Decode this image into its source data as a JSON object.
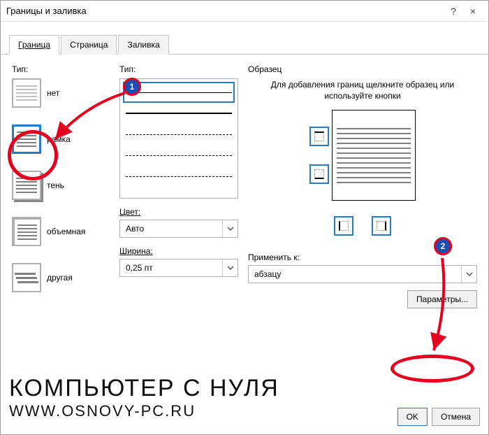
{
  "title": "Границы и заливка",
  "help": "?",
  "close": "×",
  "tabs": {
    "border": "Граница",
    "page": "Страница",
    "fill": "Заливка"
  },
  "type": {
    "label": "Тип:",
    "items": [
      "нет",
      "рамка",
      "тень",
      "объемная",
      "другая"
    ]
  },
  "style": {
    "label": "Тип:"
  },
  "color": {
    "label": "Цвет:",
    "value": "Авто"
  },
  "width": {
    "label": "Ширина:",
    "value": "0,25 пт"
  },
  "sample": {
    "label": "Образец",
    "hint": "Для добавления границ щелкните образец или используйте кнопки"
  },
  "apply": {
    "label": "Применить к:",
    "value": "абзацу"
  },
  "params": "Параметры...",
  "ok": "OK",
  "cancel": "Отмена",
  "ann": {
    "badge1": "1",
    "badge2": "2"
  },
  "wm": {
    "line1": "КОМПЬЮТЕР С НУЛЯ",
    "line2": "WWW.OSNOVY-PC.RU"
  }
}
